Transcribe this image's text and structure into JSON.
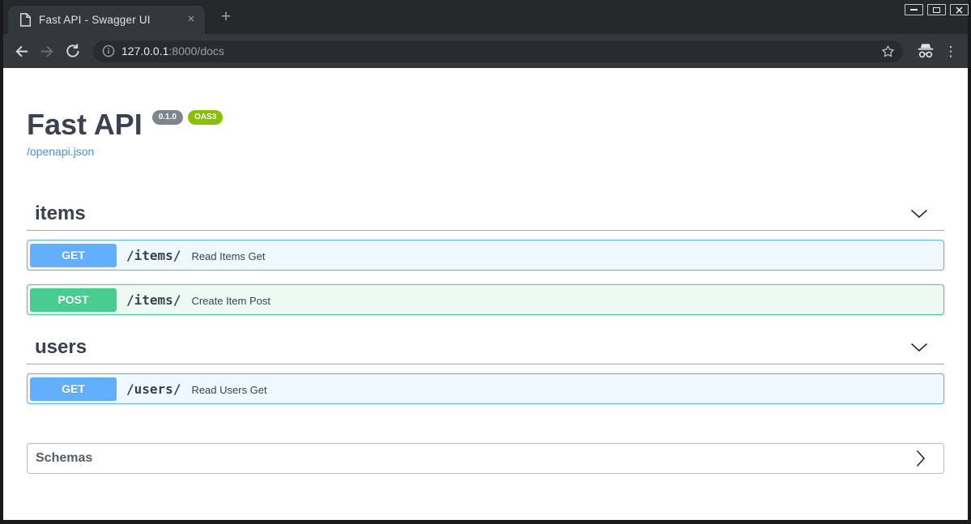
{
  "browser": {
    "tab_title": "Fast API - Swagger UI",
    "url_host": "127.0.0.1",
    "url_rest": ":8000/docs"
  },
  "icons": {
    "tab_close": "×",
    "new_tab": "+",
    "menu": "⋮"
  },
  "page": {
    "title": "Fast API",
    "version_badge": "0.1.0",
    "oas_badge": "OAS3",
    "spec_link": "/openapi.json",
    "sections": [
      {
        "name": "items",
        "operations": [
          {
            "method": "GET",
            "path": "/items/",
            "summary": "Read Items Get"
          },
          {
            "method": "POST",
            "path": "/items/",
            "summary": "Create Item Post"
          }
        ]
      },
      {
        "name": "users",
        "operations": [
          {
            "method": "GET",
            "path": "/users/",
            "summary": "Read Users Get"
          }
        ]
      }
    ],
    "schemas_label": "Schemas"
  },
  "colors": {
    "get_blue": "#61affe",
    "post_green": "#49cc90",
    "get_row_bg": "#eff7ff",
    "post_row_bg": "#edfaf4",
    "link_blue": "#4990e2",
    "version_badge_bg": "#7d8492",
    "oas_badge_bg": "#89bf04",
    "heading_text": "#3b4151",
    "frame_dark": "#26282b",
    "toolbar_dark": "#34373b"
  }
}
